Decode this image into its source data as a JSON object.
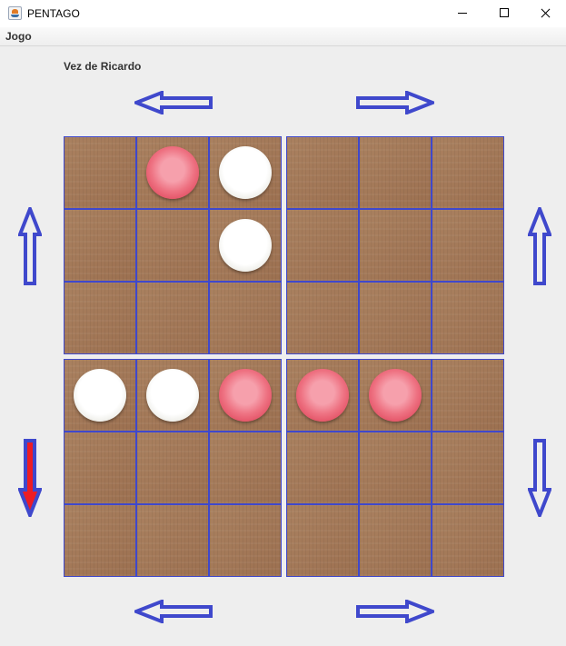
{
  "window": {
    "title": "PENTAGO"
  },
  "menu": {
    "items": [
      "Jogo"
    ]
  },
  "status": {
    "text": "Vez de Ricardo"
  },
  "colors": {
    "grid_line": "#3f48cc",
    "arrow": "#3f48cc",
    "arrow_highlight": "#ed1c24",
    "board_wood": "#a57a56"
  },
  "board": {
    "quadrants": [
      {
        "name": "top-left",
        "cells": [
          "",
          "red",
          "white",
          "",
          "",
          "white",
          "",
          "",
          ""
        ]
      },
      {
        "name": "top-right",
        "cells": [
          "",
          "",
          "",
          "",
          "",
          "",
          "",
          "",
          ""
        ]
      },
      {
        "name": "bottom-left",
        "cells": [
          "white",
          "white",
          "red",
          "",
          "",
          "",
          "",
          "",
          ""
        ]
      },
      {
        "name": "bottom-right",
        "cells": [
          "red",
          "red",
          "",
          "",
          "",
          "",
          "",
          "",
          ""
        ]
      }
    ]
  },
  "rotation_arrows": [
    {
      "id": "top-left-rotate-left",
      "direction": "left",
      "highlighted": false
    },
    {
      "id": "top-right-rotate-right",
      "direction": "right",
      "highlighted": false
    },
    {
      "id": "top-left-rotate-up",
      "direction": "up",
      "highlighted": false
    },
    {
      "id": "top-right-rotate-up",
      "direction": "up",
      "highlighted": false
    },
    {
      "id": "bottom-left-rotate-down",
      "direction": "down",
      "highlighted": true
    },
    {
      "id": "bottom-right-rotate-down",
      "direction": "down",
      "highlighted": false
    },
    {
      "id": "bottom-left-rotate-left",
      "direction": "left",
      "highlighted": false
    },
    {
      "id": "bottom-right-rotate-right",
      "direction": "right",
      "highlighted": false
    }
  ]
}
